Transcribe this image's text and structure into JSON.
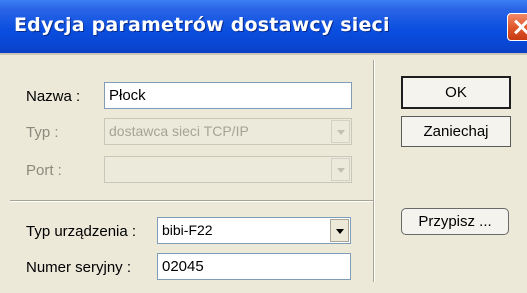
{
  "window": {
    "title": "Edycja parametrów dostawcy sieci"
  },
  "fields": {
    "name": {
      "label": "Nazwa :",
      "value": "Płock"
    },
    "type": {
      "label": "Typ :",
      "value": "dostawca sieci TCP/IP"
    },
    "port": {
      "label": "Port :",
      "value": ""
    },
    "device_type": {
      "label": "Typ urządzenia :",
      "value": "bibi-F22"
    },
    "serial": {
      "label": "Numer seryjny :",
      "value": "02045"
    }
  },
  "buttons": {
    "ok": "OK",
    "cancel": "Zaniechaj",
    "assign": "Przypisz ..."
  },
  "icons": {
    "close": "close-icon",
    "dropdown": "chevron-down-icon"
  },
  "colors": {
    "titlebar": "#0a4fe0",
    "dialog_bg": "#ece9d8",
    "close_button": "#e0582c"
  }
}
